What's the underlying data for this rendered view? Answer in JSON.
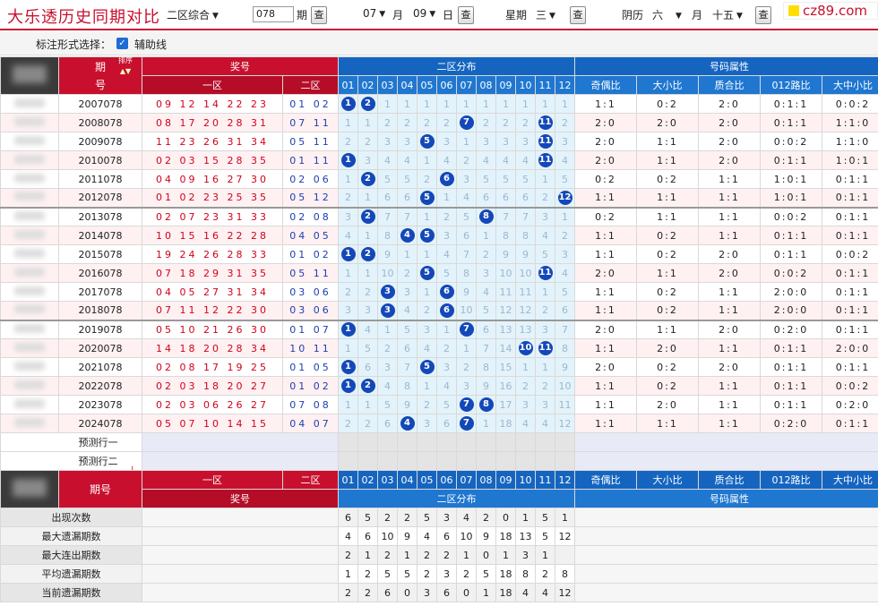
{
  "topbar": {
    "title": "大乐透历史同期对比",
    "zone_select": "二区综合",
    "issue_value": "078",
    "issue_label": "期",
    "query": "查",
    "month_value": "07",
    "month_label": "月",
    "day_value": "09",
    "day_label": "日",
    "week_label": "星期",
    "week_value": "三",
    "lunar_label": "阴历",
    "lunar_month_value": "六",
    "lunar_month_label": "月",
    "lunar_day_value": "十五",
    "logo": "cz89.com"
  },
  "filter": {
    "label": "标注形式选择：",
    "checkbox_label": "辅助线",
    "checked": true
  },
  "header": {
    "issue": "期号",
    "sort": "排序",
    "prize": "奖号",
    "zone1": "一区",
    "zone2": "二区",
    "dist": "二区分布",
    "attr": "号码属性",
    "cols": [
      "01",
      "02",
      "03",
      "04",
      "05",
      "06",
      "07",
      "08",
      "09",
      "10",
      "11",
      "12"
    ],
    "attrs": [
      "奇偶比",
      "大小比",
      "质合比",
      "012路比",
      "大中小比"
    ]
  },
  "rows": [
    {
      "issue": "2007078",
      "front": "09 12 14 22 23",
      "back": "01 02",
      "dist": [
        "B",
        "B",
        "1",
        "1",
        "1",
        "1",
        "1",
        "1",
        "1",
        "1",
        "1",
        "1"
      ],
      "attrs": [
        "1:1",
        "0:2",
        "2:0",
        "0:1:1",
        "0:0:2"
      ]
    },
    {
      "issue": "2008078",
      "front": "08 17 20 28 31",
      "back": "07 11",
      "dist": [
        "1",
        "1",
        "2",
        "2",
        "2",
        "2",
        "B",
        "2",
        "2",
        "2",
        "B",
        "2"
      ],
      "attrs": [
        "2:0",
        "2:0",
        "2:0",
        "0:1:1",
        "1:1:0"
      ]
    },
    {
      "issue": "2009078",
      "front": "11 23 26 31 34",
      "back": "05 11",
      "dist": [
        "2",
        "2",
        "3",
        "3",
        "B",
        "3",
        "1",
        "3",
        "3",
        "3",
        "B",
        "3"
      ],
      "attrs": [
        "2:0",
        "1:1",
        "2:0",
        "0:0:2",
        "1:1:0"
      ]
    },
    {
      "issue": "2010078",
      "front": "02 03 15 28 35",
      "back": "01 11",
      "dist": [
        "B",
        "3",
        "4",
        "4",
        "1",
        "4",
        "2",
        "4",
        "4",
        "4",
        "B",
        "4"
      ],
      "attrs": [
        "2:0",
        "1:1",
        "2:0",
        "0:1:1",
        "1:0:1"
      ]
    },
    {
      "issue": "2011078",
      "front": "04 09 16 27 30",
      "back": "02 06",
      "dist": [
        "1",
        "B",
        "5",
        "5",
        "2",
        "B",
        "3",
        "5",
        "5",
        "5",
        "1",
        "5"
      ],
      "attrs": [
        "0:2",
        "0:2",
        "1:1",
        "1:0:1",
        "0:1:1"
      ]
    },
    {
      "issue": "2012078",
      "front": "01 02 23 25 35",
      "back": "05 12",
      "dist": [
        "2",
        "1",
        "6",
        "6",
        "B",
        "1",
        "4",
        "6",
        "6",
        "6",
        "2",
        "B"
      ],
      "attrs": [
        "1:1",
        "1:1",
        "1:1",
        "1:0:1",
        "0:1:1"
      ]
    },
    {
      "issue": "2013078",
      "front": "02 07 23 31 33",
      "back": "02 08",
      "dist": [
        "3",
        "B",
        "7",
        "7",
        "1",
        "2",
        "5",
        "B",
        "7",
        "7",
        "3",
        "1"
      ],
      "attrs": [
        "0:2",
        "1:1",
        "1:1",
        "0:0:2",
        "0:1:1"
      ]
    },
    {
      "issue": "2014078",
      "front": "10 15 16 22 28",
      "back": "04 05",
      "dist": [
        "4",
        "1",
        "8",
        "B",
        "B",
        "3",
        "6",
        "1",
        "8",
        "8",
        "4",
        "2"
      ],
      "attrs": [
        "1:1",
        "0:2",
        "1:1",
        "0:1:1",
        "0:1:1"
      ]
    },
    {
      "issue": "2015078",
      "front": "19 24 26 28 33",
      "back": "01 02",
      "dist": [
        "B",
        "B",
        "9",
        "1",
        "1",
        "4",
        "7",
        "2",
        "9",
        "9",
        "5",
        "3"
      ],
      "attrs": [
        "1:1",
        "0:2",
        "2:0",
        "0:1:1",
        "0:0:2"
      ]
    },
    {
      "issue": "2016078",
      "front": "07 18 29 31 35",
      "back": "05 11",
      "dist": [
        "1",
        "1",
        "10",
        "2",
        "B",
        "5",
        "8",
        "3",
        "10",
        "10",
        "B",
        "4"
      ],
      "attrs": [
        "2:0",
        "1:1",
        "2:0",
        "0:0:2",
        "0:1:1"
      ]
    },
    {
      "issue": "2017078",
      "front": "04 05 27 31 34",
      "back": "03 06",
      "dist": [
        "2",
        "2",
        "B",
        "3",
        "1",
        "B",
        "9",
        "4",
        "11",
        "11",
        "1",
        "5"
      ],
      "attrs": [
        "1:1",
        "0:2",
        "1:1",
        "2:0:0",
        "0:1:1"
      ]
    },
    {
      "issue": "2018078",
      "front": "07 11 12 22 30",
      "back": "03 06",
      "dist": [
        "3",
        "3",
        "B",
        "4",
        "2",
        "B",
        "10",
        "5",
        "12",
        "12",
        "2",
        "6"
      ],
      "attrs": [
        "1:1",
        "0:2",
        "1:1",
        "2:0:0",
        "0:1:1"
      ]
    },
    {
      "issue": "2019078",
      "front": "05 10 21 26 30",
      "back": "01 07",
      "dist": [
        "B",
        "4",
        "1",
        "5",
        "3",
        "1",
        "B",
        "6",
        "13",
        "13",
        "3",
        "7"
      ],
      "attrs": [
        "2:0",
        "1:1",
        "2:0",
        "0:2:0",
        "0:1:1"
      ]
    },
    {
      "issue": "2020078",
      "front": "14 18 20 28 34",
      "back": "10 11",
      "dist": [
        "1",
        "5",
        "2",
        "6",
        "4",
        "2",
        "1",
        "7",
        "14",
        "B",
        "B",
        "8"
      ],
      "attrs": [
        "1:1",
        "2:0",
        "1:1",
        "0:1:1",
        "2:0:0"
      ]
    },
    {
      "issue": "2021078",
      "front": "02 08 17 19 25",
      "back": "01 05",
      "dist": [
        "B",
        "6",
        "3",
        "7",
        "B",
        "3",
        "2",
        "8",
        "15",
        "1",
        "1",
        "9"
      ],
      "attrs": [
        "2:0",
        "0:2",
        "2:0",
        "0:1:1",
        "0:1:1"
      ]
    },
    {
      "issue": "2022078",
      "front": "02 03 18 20 27",
      "back": "01 02",
      "dist": [
        "B",
        "B",
        "4",
        "8",
        "1",
        "4",
        "3",
        "9",
        "16",
        "2",
        "2",
        "10"
      ],
      "attrs": [
        "1:1",
        "0:2",
        "1:1",
        "0:1:1",
        "0:0:2"
      ]
    },
    {
      "issue": "2023078",
      "front": "02 03 06 26 27",
      "back": "07 08",
      "dist": [
        "1",
        "1",
        "5",
        "9",
        "2",
        "5",
        "B",
        "B",
        "17",
        "3",
        "3",
        "11"
      ],
      "attrs": [
        "1:1",
        "2:0",
        "1:1",
        "0:1:1",
        "0:2:0"
      ]
    },
    {
      "issue": "2024078",
      "front": "05 07 10 14 15",
      "back": "04 07",
      "dist": [
        "2",
        "2",
        "6",
        "B",
        "3",
        "6",
        "B",
        "1",
        "18",
        "4",
        "4",
        "12"
      ],
      "attrs": [
        "1:1",
        "1:1",
        "1:1",
        "0:2:0",
        "0:1:1"
      ]
    }
  ],
  "predict": [
    "预测行一",
    "预测行二"
  ],
  "footer": {
    "issue": "期号",
    "zone1": "一区",
    "zone2": "二区",
    "prize": "奖号",
    "dist": "二区分布",
    "attr": "号码属性"
  },
  "stats": [
    {
      "label": "出现次数",
      "values": [
        "6",
        "5",
        "2",
        "2",
        "5",
        "3",
        "4",
        "2",
        "0",
        "1",
        "5",
        "1"
      ]
    },
    {
      "label": "最大遗漏期数",
      "values": [
        "4",
        "6",
        "10",
        "9",
        "4",
        "6",
        "10",
        "9",
        "18",
        "13",
        "5",
        "12"
      ]
    },
    {
      "label": "最大连出期数",
      "values": [
        "2",
        "1",
        "2",
        "1",
        "2",
        "2",
        "1",
        "0",
        "1",
        "3",
        "1",
        " "
      ]
    },
    {
      "label": "平均遗漏期数",
      "values": [
        "1",
        "2",
        "5",
        "5",
        "2",
        "3",
        "2",
        "5",
        "18",
        "8",
        "2",
        "8"
      ]
    },
    {
      "label": "当前遗漏期数",
      "values": [
        "2",
        "2",
        "6",
        "0",
        "3",
        "6",
        "0",
        "1",
        "18",
        "4",
        "4",
        "12"
      ]
    }
  ],
  "colors": {
    "red": "#c8102e",
    "blue": "#1565c0",
    "ball": "#1448b8"
  }
}
